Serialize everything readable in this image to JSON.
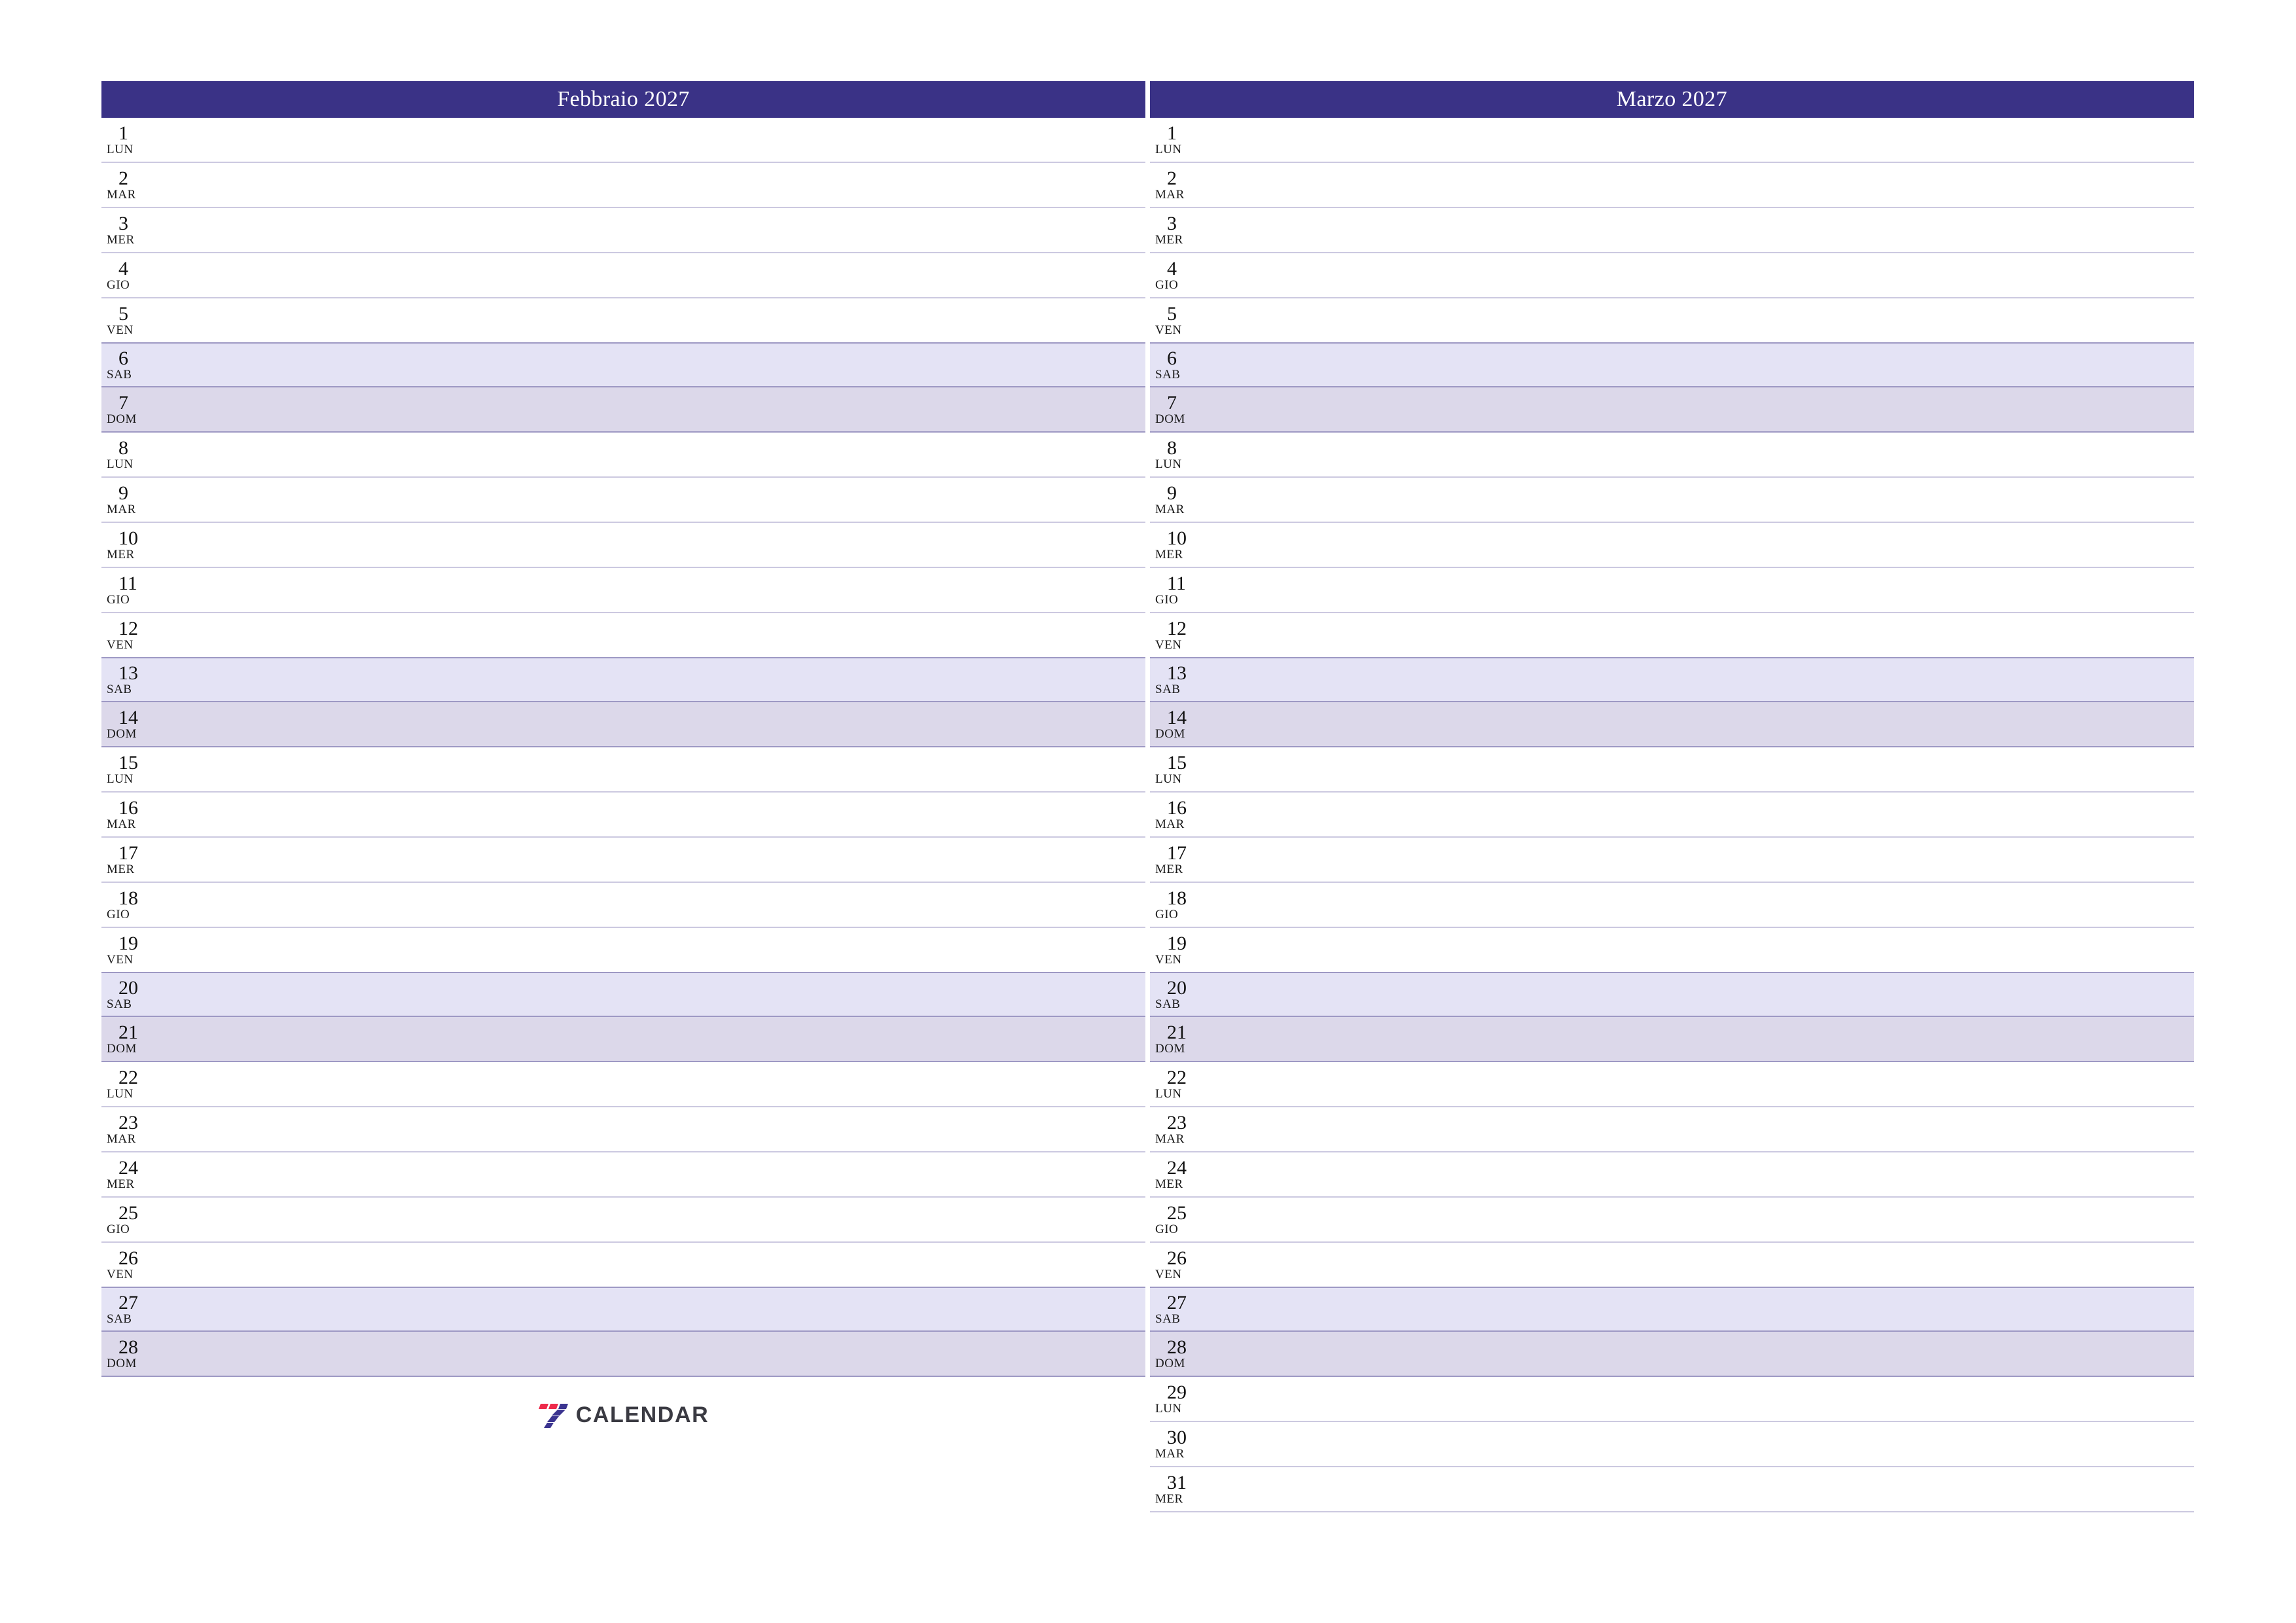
{
  "colors": {
    "header_bg": "#3a3286",
    "header_text": "#ffffff",
    "saturday_bg": "#e4e3f5",
    "sunday_bg": "#dcd8ea",
    "gridline": "#ccc9e0",
    "logo_red": "#ee2a4b",
    "logo_blue": "#3b3490",
    "logo_text": "#3a3a42"
  },
  "logo": {
    "mark_name": "seven-logo-icon",
    "text": "CALENDAR"
  },
  "months": [
    {
      "title": "Febbraio 2027",
      "days": [
        {
          "num": "1",
          "abbr": "LUN",
          "type": "weekday"
        },
        {
          "num": "2",
          "abbr": "MAR",
          "type": "weekday"
        },
        {
          "num": "3",
          "abbr": "MER",
          "type": "weekday"
        },
        {
          "num": "4",
          "abbr": "GIO",
          "type": "weekday"
        },
        {
          "num": "5",
          "abbr": "VEN",
          "type": "weekday"
        },
        {
          "num": "6",
          "abbr": "SAB",
          "type": "sat"
        },
        {
          "num": "7",
          "abbr": "DOM",
          "type": "sun"
        },
        {
          "num": "8",
          "abbr": "LUN",
          "type": "weekday"
        },
        {
          "num": "9",
          "abbr": "MAR",
          "type": "weekday"
        },
        {
          "num": "10",
          "abbr": "MER",
          "type": "weekday"
        },
        {
          "num": "11",
          "abbr": "GIO",
          "type": "weekday"
        },
        {
          "num": "12",
          "abbr": "VEN",
          "type": "weekday"
        },
        {
          "num": "13",
          "abbr": "SAB",
          "type": "sat"
        },
        {
          "num": "14",
          "abbr": "DOM",
          "type": "sun"
        },
        {
          "num": "15",
          "abbr": "LUN",
          "type": "weekday"
        },
        {
          "num": "16",
          "abbr": "MAR",
          "type": "weekday"
        },
        {
          "num": "17",
          "abbr": "MER",
          "type": "weekday"
        },
        {
          "num": "18",
          "abbr": "GIO",
          "type": "weekday"
        },
        {
          "num": "19",
          "abbr": "VEN",
          "type": "weekday"
        },
        {
          "num": "20",
          "abbr": "SAB",
          "type": "sat"
        },
        {
          "num": "21",
          "abbr": "DOM",
          "type": "sun"
        },
        {
          "num": "22",
          "abbr": "LUN",
          "type": "weekday"
        },
        {
          "num": "23",
          "abbr": "MAR",
          "type": "weekday"
        },
        {
          "num": "24",
          "abbr": "MER",
          "type": "weekday"
        },
        {
          "num": "25",
          "abbr": "GIO",
          "type": "weekday"
        },
        {
          "num": "26",
          "abbr": "VEN",
          "type": "weekday"
        },
        {
          "num": "27",
          "abbr": "SAB",
          "type": "sat"
        },
        {
          "num": "28",
          "abbr": "DOM",
          "type": "sun"
        }
      ]
    },
    {
      "title": "Marzo 2027",
      "days": [
        {
          "num": "1",
          "abbr": "LUN",
          "type": "weekday"
        },
        {
          "num": "2",
          "abbr": "MAR",
          "type": "weekday"
        },
        {
          "num": "3",
          "abbr": "MER",
          "type": "weekday"
        },
        {
          "num": "4",
          "abbr": "GIO",
          "type": "weekday"
        },
        {
          "num": "5",
          "abbr": "VEN",
          "type": "weekday"
        },
        {
          "num": "6",
          "abbr": "SAB",
          "type": "sat"
        },
        {
          "num": "7",
          "abbr": "DOM",
          "type": "sun"
        },
        {
          "num": "8",
          "abbr": "LUN",
          "type": "weekday"
        },
        {
          "num": "9",
          "abbr": "MAR",
          "type": "weekday"
        },
        {
          "num": "10",
          "abbr": "MER",
          "type": "weekday"
        },
        {
          "num": "11",
          "abbr": "GIO",
          "type": "weekday"
        },
        {
          "num": "12",
          "abbr": "VEN",
          "type": "weekday"
        },
        {
          "num": "13",
          "abbr": "SAB",
          "type": "sat"
        },
        {
          "num": "14",
          "abbr": "DOM",
          "type": "sun"
        },
        {
          "num": "15",
          "abbr": "LUN",
          "type": "weekday"
        },
        {
          "num": "16",
          "abbr": "MAR",
          "type": "weekday"
        },
        {
          "num": "17",
          "abbr": "MER",
          "type": "weekday"
        },
        {
          "num": "18",
          "abbr": "GIO",
          "type": "weekday"
        },
        {
          "num": "19",
          "abbr": "VEN",
          "type": "weekday"
        },
        {
          "num": "20",
          "abbr": "SAB",
          "type": "sat"
        },
        {
          "num": "21",
          "abbr": "DOM",
          "type": "sun"
        },
        {
          "num": "22",
          "abbr": "LUN",
          "type": "weekday"
        },
        {
          "num": "23",
          "abbr": "MAR",
          "type": "weekday"
        },
        {
          "num": "24",
          "abbr": "MER",
          "type": "weekday"
        },
        {
          "num": "25",
          "abbr": "GIO",
          "type": "weekday"
        },
        {
          "num": "26",
          "abbr": "VEN",
          "type": "weekday"
        },
        {
          "num": "27",
          "abbr": "SAB",
          "type": "sat"
        },
        {
          "num": "28",
          "abbr": "DOM",
          "type": "sun"
        },
        {
          "num": "29",
          "abbr": "LUN",
          "type": "weekday"
        },
        {
          "num": "30",
          "abbr": "MAR",
          "type": "weekday"
        },
        {
          "num": "31",
          "abbr": "MER",
          "type": "weekday"
        }
      ]
    }
  ]
}
